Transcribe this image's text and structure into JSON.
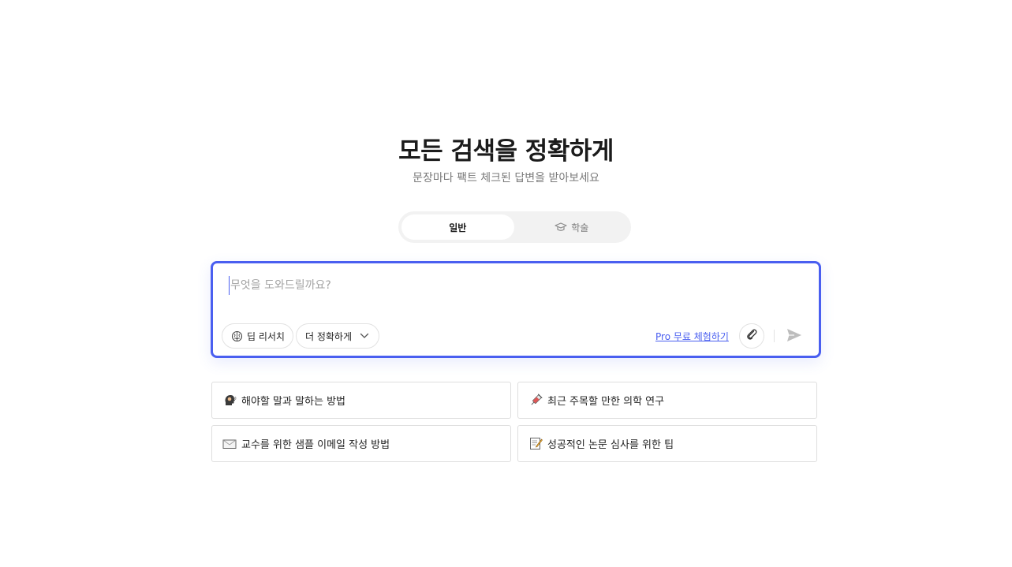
{
  "hero": {
    "title": "모든 검색을 정확하게",
    "subtitle": "문장마다 팩트 체크된 답변을 받아보세요"
  },
  "mode_toggle": {
    "tabs": [
      {
        "label": "일반",
        "active": true
      },
      {
        "label": "학술",
        "active": false,
        "icon": "graduation-cap-icon"
      }
    ]
  },
  "search": {
    "placeholder": "무엇을 도와드릴까요?",
    "value": "",
    "chips": [
      {
        "label": "딥 리서치",
        "icon": "brain-icon"
      },
      {
        "label": "더 정확하게",
        "icon": "chevron-down-icon"
      }
    ],
    "pro_link": "Pro 무료 체험하기",
    "attach_icon": "paperclip-icon",
    "send_icon": "send-icon"
  },
  "suggestions": [
    {
      "label": "해야할 말과 말하는 방법",
      "icon": "speaking-head-icon"
    },
    {
      "label": "최근 주목할 만한 의학 연구",
      "icon": "syringe-icon"
    },
    {
      "label": "교수를 위한 샘플 이메일 작성 방법",
      "icon": "envelope-icon"
    },
    {
      "label": "성공적인 논문 심사를 위한 팁",
      "icon": "memo-icon"
    }
  ],
  "colors": {
    "accent": "#4a5ff0",
    "muted_text": "#7a7a7a",
    "toggle_bg": "#f2f2f2"
  }
}
